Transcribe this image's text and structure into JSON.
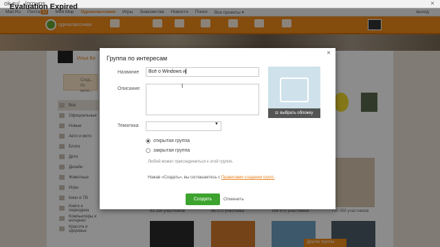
{
  "browser": {
    "url": "ok.ru/.../groups",
    "watermark": "Evaluation Expired",
    "close": "×"
  },
  "mailbar": {
    "items": [
      "Mail.Ru",
      "Почта",
      "Мой Мир",
      "Одноклассники",
      "Игры",
      "Знакомства",
      "Новости",
      "Поиск",
      "Все проекты ▾"
    ],
    "mail_badge": "32",
    "exit": "выход"
  },
  "topbar": {
    "logo": "одноклассники"
  },
  "profile": {
    "name": "Илья Бе",
    "create_label": "Созд...\nпо инте..."
  },
  "sidebar": {
    "items": [
      "Все",
      "Официальные",
      "Новые",
      "Авто и мото",
      "Блоги",
      "Дети",
      "Дизайн",
      "Животные",
      "Игры",
      "Кино и ТВ",
      "Книги и периодика",
      "Компьютеры и интернет",
      "Красота и здоровье"
    ]
  },
  "grid": {
    "counts": [
      "83 259 участников",
      "86 072 участника",
      "164 975 участников",
      "790 058 участников"
    ],
    "promo": "Другие группы"
  },
  "modal": {
    "title": "Группа по интересам",
    "close": "×",
    "name_label": "Название",
    "name_value": "Всё о Windows и",
    "desc_label": "Описание",
    "theme_label": "Тематика",
    "theme_value": "",
    "radio_open": "открытая группа",
    "radio_closed": "закрытая группа",
    "hint": "Любой может присоединиться к этой группе.",
    "terms_prefix": "Нажав «Создать», вы соглашаетесь с",
    "terms_link": "Правилами создания групп.",
    "create_button": "Создать",
    "cancel": "Отменить",
    "cover_button": "выбрать обложку"
  },
  "colors": {
    "accent": "#f08a18",
    "create_green": "#3ca32e",
    "cover_bg": "#cfe2eb"
  }
}
